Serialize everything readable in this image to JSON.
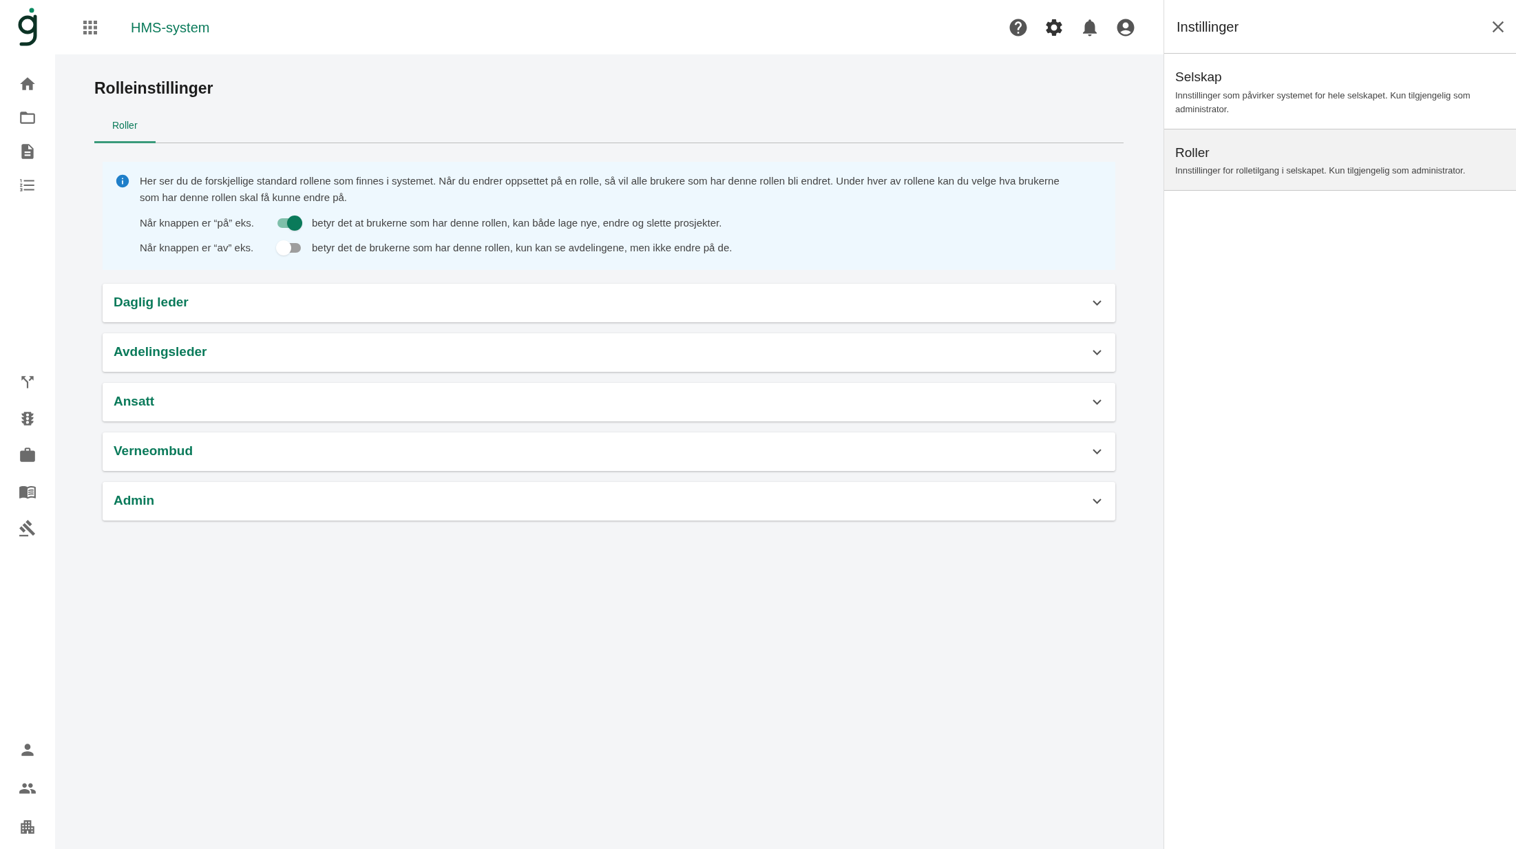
{
  "header": {
    "app_title": "HMS-system"
  },
  "page": {
    "title": "Rolleinstillinger",
    "tabs": [
      {
        "label": "Roller",
        "selected": true
      }
    ],
    "info": {
      "text": "Her ser du de forskjellige standard rollene som finnes i systemet. Når du endrer oppsettet på en rolle, så vil alle brukere som har denne rollen bli endret. Under hver av rollene kan du velge hva brukerne som har denne rollen skal få kunne endre på.",
      "examples": [
        {
          "label": "Når knappen er “på” eks.",
          "on": true,
          "description": "betyr det at brukerne som har denne rollen, kan både lage nye, endre og slette prosjekter."
        },
        {
          "label": "Når knappen er “av” eks.",
          "on": false,
          "description": "betyr det de brukerne som har denne rollen, kun kan se avdelingene, men ikke endre på de."
        }
      ]
    },
    "roles": [
      {
        "name": "Daglig leder",
        "expanded": false
      },
      {
        "name": "Avdelingsleder",
        "expanded": false
      },
      {
        "name": "Ansatt",
        "expanded": false
      },
      {
        "name": "Verneombud",
        "expanded": false
      },
      {
        "name": "Admin",
        "expanded": false
      }
    ]
  },
  "settings_panel": {
    "title": "Instillinger",
    "items": [
      {
        "title": "Selskap",
        "description": "Innstillinger som påvirker systemet for hele selskapet. Kun tilgjengelig som administrator.",
        "selected": false
      },
      {
        "title": "Roller",
        "description": "Innstillinger for rolletilgang i selskapet. Kun tilgjengelig som administrator.",
        "selected": true
      }
    ]
  }
}
